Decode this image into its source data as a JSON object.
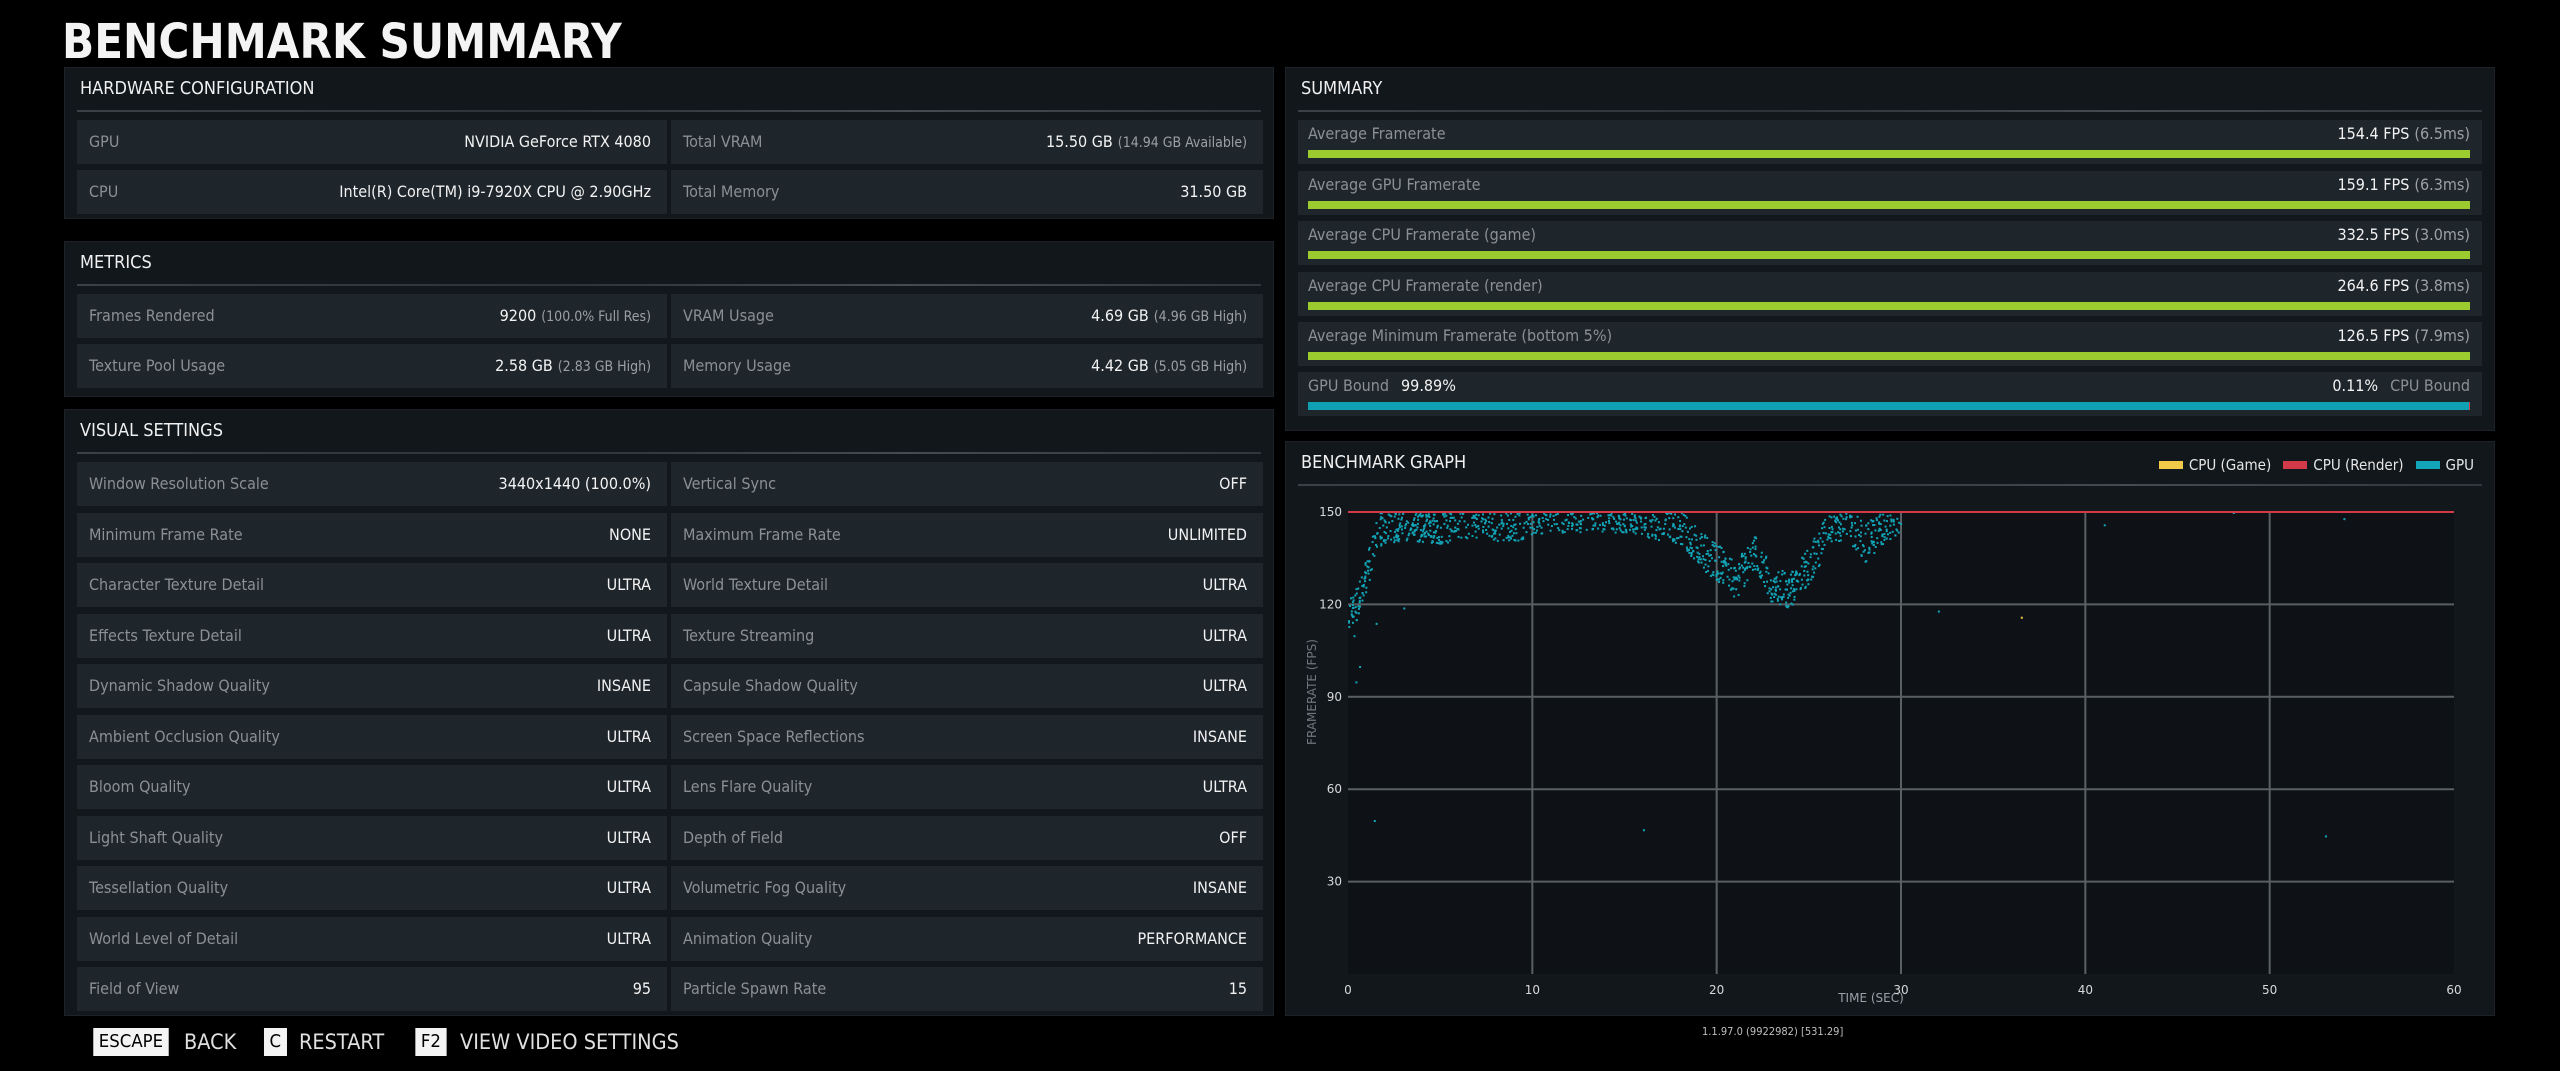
{
  "page_title": "BENCHMARK SUMMARY",
  "hardware": {
    "title": "HARDWARE CONFIGURATION",
    "rows": [
      {
        "label": "GPU",
        "value": "NVIDIA GeForce RTX 4080",
        "sub": ""
      },
      {
        "label": "Total VRAM",
        "value": "15.50 GB",
        "sub": "(14.94 GB Available)"
      },
      {
        "label": "CPU",
        "value": "Intel(R) Core(TM) i9-7920X CPU @ 2.90GHz",
        "sub": ""
      },
      {
        "label": "Total Memory",
        "value": "31.50 GB",
        "sub": ""
      }
    ]
  },
  "metrics": {
    "title": "METRICS",
    "rows": [
      {
        "label": "Frames Rendered",
        "value": "9200",
        "sub": "(100.0% Full Res)"
      },
      {
        "label": "VRAM Usage",
        "value": "4.69 GB",
        "sub": "(4.96 GB High)"
      },
      {
        "label": "Texture Pool Usage",
        "value": "2.58 GB",
        "sub": "(2.83 GB High)"
      },
      {
        "label": "Memory Usage",
        "value": "4.42 GB",
        "sub": "(5.05 GB High)"
      }
    ]
  },
  "visual_settings": {
    "title": "VISUAL SETTINGS",
    "rows": [
      {
        "label": "Window Resolution Scale",
        "value": "3440x1440 (100.0%)"
      },
      {
        "label": "Vertical Sync",
        "value": "OFF"
      },
      {
        "label": "Minimum Frame Rate",
        "value": "NONE"
      },
      {
        "label": "Maximum Frame Rate",
        "value": "UNLIMITED"
      },
      {
        "label": "Character Texture Detail",
        "value": "ULTRA"
      },
      {
        "label": "World Texture Detail",
        "value": "ULTRA"
      },
      {
        "label": "Effects Texture Detail",
        "value": "ULTRA"
      },
      {
        "label": "Texture Streaming",
        "value": "ULTRA"
      },
      {
        "label": "Dynamic Shadow Quality",
        "value": "INSANE"
      },
      {
        "label": "Capsule Shadow Quality",
        "value": "ULTRA"
      },
      {
        "label": "Ambient Occlusion Quality",
        "value": "ULTRA"
      },
      {
        "label": "Screen Space Reflections",
        "value": "INSANE"
      },
      {
        "label": "Bloom Quality",
        "value": "ULTRA"
      },
      {
        "label": "Lens Flare Quality",
        "value": "ULTRA"
      },
      {
        "label": "Light Shaft Quality",
        "value": "ULTRA"
      },
      {
        "label": "Depth of Field",
        "value": "OFF"
      },
      {
        "label": "Tessellation Quality",
        "value": "ULTRA"
      },
      {
        "label": "Volumetric Fog Quality",
        "value": "INSANE"
      },
      {
        "label": "World Level of Detail",
        "value": "ULTRA"
      },
      {
        "label": "Animation Quality",
        "value": "PERFORMANCE"
      },
      {
        "label": "Field of View",
        "value": "95"
      },
      {
        "label": "Particle Spawn Rate",
        "value": "15"
      }
    ]
  },
  "summary": {
    "title": "SUMMARY",
    "bar_color": "#9bcb2e",
    "rows": [
      {
        "label": "Average Framerate",
        "value": "154.4 FPS",
        "sub": "(6.5ms)",
        "fill": 1.0
      },
      {
        "label": "Average GPU Framerate",
        "value": "159.1 FPS",
        "sub": "(6.3ms)",
        "fill": 1.0
      },
      {
        "label": "Average CPU Framerate (game)",
        "value": "332.5 FPS",
        "sub": "(3.0ms)",
        "fill": 1.0
      },
      {
        "label": "Average CPU Framerate (render)",
        "value": "264.6 FPS",
        "sub": "(3.8ms)",
        "fill": 1.0
      },
      {
        "label": "Average Minimum Framerate (bottom 5%)",
        "value": "126.5 FPS",
        "sub": "(7.9ms)",
        "fill": 1.0
      }
    ],
    "bound": {
      "gpu_label": "GPU Bound",
      "gpu_value": "99.89%",
      "cpu_value": "0.11%",
      "cpu_label": "CPU Bound",
      "gpu_fraction": 0.9989,
      "gpu_color": "#0fa0b4",
      "cpu_color": "#d23a4a"
    }
  },
  "graph": {
    "title": "BENCHMARK GRAPH",
    "legend": [
      {
        "label": "CPU (Game)",
        "color": "#f0c84a"
      },
      {
        "label": "CPU (Render)",
        "color": "#d23a4a"
      },
      {
        "label": "GPU",
        "color": "#12a5b8"
      }
    ]
  },
  "chart_data": {
    "type": "scatter",
    "title": "BENCHMARK GRAPH",
    "xlabel": "TIME (SEC)",
    "ylabel": "FRAMERATE (FPS)",
    "xlim": [
      0,
      60
    ],
    "ylim": [
      0,
      150
    ],
    "xticks": [
      0,
      10,
      20,
      30,
      40,
      50,
      60
    ],
    "yticks": [
      30,
      60,
      90,
      120,
      150
    ],
    "grid": true,
    "legend_position": "top-right",
    "series": [
      {
        "name": "CPU (Game)",
        "color": "#f0c84a",
        "note": "mostly above 150 FPS (clipped)",
        "points": [
          [
            36.5,
            116
          ]
        ]
      },
      {
        "name": "CPU (Render)",
        "color": "#d23a4a",
        "note": "at or above 150 FPS across the run (clipped at top)",
        "line_value": 150,
        "x_range": [
          0,
          60
        ]
      },
      {
        "name": "GPU",
        "color": "#12a5b8",
        "trend": [
          [
            0,
            115
          ],
          [
            0.5,
            122
          ],
          [
            1,
            130
          ],
          [
            1.5,
            145
          ],
          [
            3,
            147
          ],
          [
            5,
            146
          ],
          [
            7,
            148
          ],
          [
            9,
            146
          ],
          [
            10,
            149
          ],
          [
            14,
            150
          ],
          [
            16,
            148
          ],
          [
            18,
            146
          ],
          [
            19,
            138
          ],
          [
            20,
            134
          ],
          [
            21,
            128
          ],
          [
            22,
            137
          ],
          [
            23,
            126
          ],
          [
            24,
            125
          ],
          [
            25,
            133
          ],
          [
            26,
            144
          ],
          [
            27,
            148
          ],
          [
            28,
            140
          ],
          [
            29,
            146
          ],
          [
            30,
            150
          ],
          [
            40,
            150
          ],
          [
            50,
            150
          ],
          [
            60,
            150
          ]
        ],
        "outliers": [
          [
            0.3,
            110
          ],
          [
            0.6,
            100
          ],
          [
            0.4,
            95
          ],
          [
            1.5,
            114
          ],
          [
            1.4,
            50
          ],
          [
            3,
            119
          ],
          [
            16,
            47
          ],
          [
            32,
            118
          ],
          [
            41,
            146
          ],
          [
            48,
            150
          ],
          [
            53,
            45
          ],
          [
            54,
            148
          ]
        ]
      }
    ]
  },
  "footer": {
    "keys": [
      {
        "key": "ESCAPE",
        "label": "BACK"
      },
      {
        "key": "C",
        "label": "RESTART"
      },
      {
        "key": "F2",
        "label": "VIEW VIDEO SETTINGS"
      }
    ],
    "version": "1.1.97.0 (9922982) [531.29]"
  }
}
